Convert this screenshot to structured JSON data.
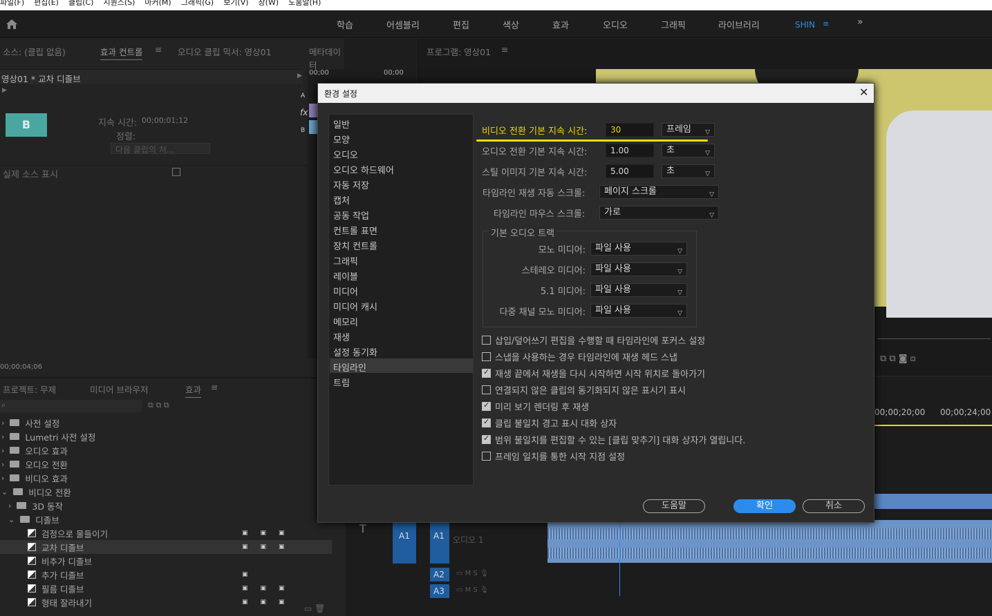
{
  "menu": [
    "파일(F)",
    "편집(E)",
    "클립(C)",
    "시퀀스(S)",
    "마커(M)",
    "그래픽(G)",
    "보기(V)",
    "창(W)",
    "도움말(H)"
  ],
  "workspaces": [
    "학습",
    "어셈블리",
    "편집",
    "색상",
    "효과",
    "오디오",
    "그래픽",
    "라이브러리",
    "SHIN"
  ],
  "source_panel": {
    "tabs": [
      "소스: (클립 없음)",
      "효과 컨트롤",
      "오디오 클립 믹서: 영상01",
      "메타데이터"
    ],
    "clip_name": "영상01 * 교차 디졸브",
    "duration_label": "지속 시간:",
    "duration_value": "00;00;01;12",
    "align_label": "정렬:",
    "align_value": "다음 클립의 처...",
    "thumb_letter": "B",
    "show_source": "실제 소스 표시",
    "timecode": "00;00;04;06",
    "ruler": [
      "00;00",
      "00;00"
    ],
    "track_a": "A",
    "track_b": "B"
  },
  "program_panel": {
    "title": "프로그램: 영상01"
  },
  "project_panel": {
    "tabs": [
      "프로젝트: 무제",
      "미디어 브라우저",
      "효과"
    ],
    "items": [
      {
        "label": "사전 설정",
        "indent": 0,
        "type": "folder"
      },
      {
        "label": "Lumetri 사전 설정",
        "indent": 0,
        "type": "folder"
      },
      {
        "label": "오디오 효과",
        "indent": 0,
        "type": "folder"
      },
      {
        "label": "오디오 전환",
        "indent": 0,
        "type": "folder"
      },
      {
        "label": "비디오 효과",
        "indent": 0,
        "type": "folder"
      },
      {
        "label": "비디오 전환",
        "indent": 0,
        "type": "folder"
      },
      {
        "label": "3D 동작",
        "indent": 1,
        "type": "folder"
      },
      {
        "label": "디졸브",
        "indent": 1,
        "type": "folder"
      },
      {
        "label": "검정으로 물들이기",
        "indent": 2,
        "type": "transition"
      },
      {
        "label": "교차 디졸브",
        "indent": 2,
        "type": "transition"
      },
      {
        "label": "비추가 디졸브",
        "indent": 2,
        "type": "transition"
      },
      {
        "label": "추가 디졸브",
        "indent": 2,
        "type": "transition"
      },
      {
        "label": "필름 디졸브",
        "indent": 2,
        "type": "transition"
      },
      {
        "label": "형태 잘라내기",
        "indent": 2,
        "type": "transition"
      }
    ]
  },
  "timeline": {
    "ruler": [
      "00;00;20;00",
      "00;00;24;00"
    ],
    "tracks": [
      "A1",
      "A2",
      "A3"
    ],
    "audio_label": "오디오 1",
    "src_a1": "A1"
  },
  "dialog": {
    "title": "환경 설정",
    "categories": [
      "일반",
      "모양",
      "오디오",
      "오디오 하드웨어",
      "자동 저장",
      "캡처",
      "공동 작업",
      "컨트롤 표면",
      "장치 컨트롤",
      "그래픽",
      "레이블",
      "미디어",
      "미디어 캐시",
      "메모리",
      "재생",
      "설정 동기화",
      "타임라인",
      "트림"
    ],
    "selected_category": "타임라인",
    "video_transition_label": "비디오 전환 기본 지속 시간:",
    "video_transition_value": "30",
    "video_transition_unit": "프레임",
    "audio_transition_label": "오디오 전환 기본 지속 시간:",
    "audio_transition_value": "1.00",
    "audio_transition_unit": "초",
    "still_label": "스틸 이미지 기본 지속 시간:",
    "still_value": "5.00",
    "still_unit": "초",
    "autoscroll_label": "타임라인 재생 자동 스크롤:",
    "autoscroll_value": "페이지 스크롤",
    "mousescroll_label": "타임라인 마우스 스크롤:",
    "mousescroll_value": "가로",
    "audio_group": "기본 오디오 트랙",
    "mono_label": "모노 미디어:",
    "mono_value": "파일 사용",
    "stereo_label": "스테레오 미디어:",
    "stereo_value": "파일 사용",
    "surround_label": "5.1 미디어:",
    "surround_value": "파일 사용",
    "multi_label": "다중 채널 모노 미디어:",
    "multi_value": "파일 사용",
    "checkboxes": [
      {
        "label": "삽입/덮어쓰기 편집을 수행할 때 타임라인에 포커스 설정",
        "checked": false
      },
      {
        "label": "스냅을 사용하는 경우 타임라인에 재생 헤드 스냅",
        "checked": false
      },
      {
        "label": "재생 끝에서 재생을 다시 시작하면 시작 위치로 돌아가기",
        "checked": true
      },
      {
        "label": "연결되지 않은 클립의 동기화되지 않은 표시기 표시",
        "checked": false
      },
      {
        "label": "미리 보기 렌더링 후 재생",
        "checked": true
      },
      {
        "label": "클립 불일치 경고 표시 대화 상자",
        "checked": true
      },
      {
        "label": "범위 불일치를 편집할 수 있는 [클립 맞추기] 대화 상자가 열립니다.",
        "checked": true
      },
      {
        "label": "프레임 일치를 통한 시작 지점 설정",
        "checked": false
      }
    ],
    "help_button": "도움말",
    "ok_button": "확인",
    "cancel_button": "취소",
    "accent_color": "#2d8ceb",
    "highlight_color": "#e8e000"
  }
}
